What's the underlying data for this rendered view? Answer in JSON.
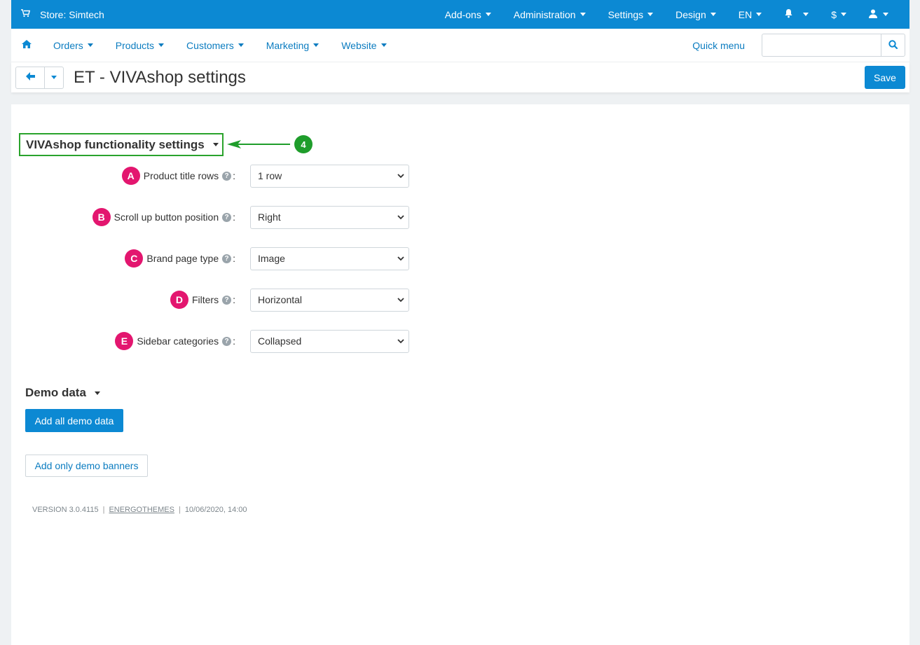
{
  "topbar": {
    "store_label": "Store: Simtech",
    "menus": [
      {
        "label": "Add-ons"
      },
      {
        "label": "Administration"
      },
      {
        "label": "Settings"
      },
      {
        "label": "Design"
      },
      {
        "label": "EN"
      },
      {
        "label": ""
      },
      {
        "label": "$"
      },
      {
        "label": ""
      }
    ]
  },
  "nav": {
    "items": [
      {
        "label": "Orders"
      },
      {
        "label": "Products"
      },
      {
        "label": "Customers"
      },
      {
        "label": "Marketing"
      },
      {
        "label": "Website"
      }
    ],
    "quick_menu": "Quick menu",
    "search_placeholder": ""
  },
  "header": {
    "title": "ET - VIVAshop settings",
    "save_label": "Save"
  },
  "settings_section": {
    "title": "VIVAshop functionality settings",
    "annotation": "4",
    "fields": [
      {
        "badge": "A",
        "label": "Product title rows",
        "value": "1 row"
      },
      {
        "badge": "B",
        "label": "Scroll up button position",
        "value": "Right"
      },
      {
        "badge": "C",
        "label": "Brand page type",
        "value": "Image"
      },
      {
        "badge": "D",
        "label": "Filters",
        "value": "Horizontal"
      },
      {
        "badge": "E",
        "label": "Sidebar categories",
        "value": "Collapsed"
      }
    ]
  },
  "demo_section": {
    "title": "Demo data",
    "add_all_label": "Add all demo data",
    "add_banners_label": "Add only demo banners"
  },
  "footer": {
    "version": "VERSION 3.0.4115",
    "vendor": "ENERGOTHEMES",
    "date": "10/06/2020, 14:00"
  },
  "colors": {
    "brand_blue": "#0c89d3",
    "annotation_green": "#2aa32c",
    "badge_pink": "#e3166f"
  }
}
